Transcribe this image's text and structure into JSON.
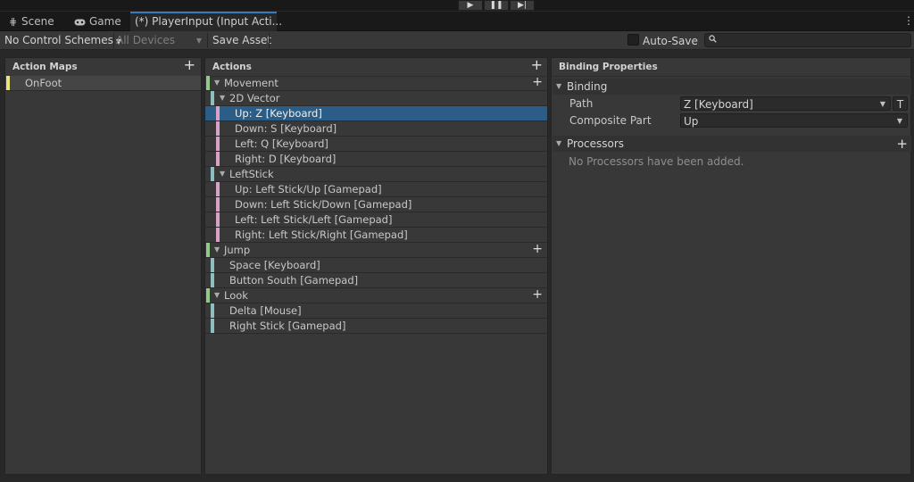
{
  "playbar": {
    "play_icon": "▶",
    "pause_icon": "❚❚",
    "step_icon": "▶|"
  },
  "tabs": [
    {
      "label": "Scene",
      "icon": "grid-icon"
    },
    {
      "label": "Game",
      "icon": "gamepad-icon"
    },
    {
      "label": "(*) PlayerInput (Input Acti...",
      "icon": ""
    }
  ],
  "toolbar": {
    "control_schemes": "No Control Schemes",
    "devices": "All Devices",
    "save_asset": "Save Asset",
    "auto_save": "Auto-Save",
    "search_placeholder": ""
  },
  "action_maps": {
    "title": "Action Maps",
    "items": [
      {
        "label": "OnFoot",
        "color": "#e8e37a"
      }
    ]
  },
  "actions": {
    "title": "Actions",
    "rows": [
      {
        "label": "Movement"
      },
      {
        "label": "2D Vector"
      },
      {
        "label": "Up: Z [Keyboard]"
      },
      {
        "label": "Down: S [Keyboard]"
      },
      {
        "label": "Left: Q [Keyboard]"
      },
      {
        "label": "Right: D [Keyboard]"
      },
      {
        "label": "LeftStick"
      },
      {
        "label": "Up: Left Stick/Up [Gamepad]"
      },
      {
        "label": "Down: Left Stick/Down [Gamepad]"
      },
      {
        "label": "Left: Left Stick/Left [Gamepad]"
      },
      {
        "label": "Right: Left Stick/Right [Gamepad]"
      },
      {
        "label": "Jump"
      },
      {
        "label": "Space [Keyboard]"
      },
      {
        "label": "Button South [Gamepad]"
      },
      {
        "label": "Look"
      },
      {
        "label": "Delta [Mouse]"
      },
      {
        "label": "Right Stick [Gamepad]"
      }
    ],
    "colors": {
      "action": "#92c98a",
      "binding": "#8dbfbf",
      "part": "#d6a3c4"
    }
  },
  "binding_properties": {
    "title": "Binding Properties",
    "binding_section": "Binding",
    "path_label": "Path",
    "path_value": "Z [Keyboard]",
    "t_button": "T",
    "composite_label": "Composite Part",
    "composite_value": "Up",
    "processors_section": "Processors",
    "processors_empty": "No Processors have been added."
  }
}
